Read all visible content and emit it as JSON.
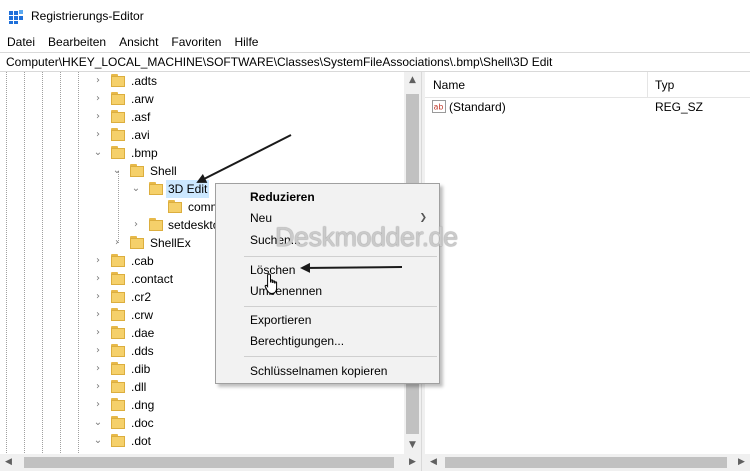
{
  "window": {
    "title": "Registrierungs-Editor"
  },
  "menu": [
    "Datei",
    "Bearbeiten",
    "Ansicht",
    "Favoriten",
    "Hilfe"
  ],
  "address": "Computer\\HKEY_LOCAL_MACHINE\\SOFTWARE\\Classes\\SystemFileAssociations\\.bmp\\Shell\\3D Edit",
  "tree": {
    "items": [
      {
        "label": ".adts"
      },
      {
        "label": ".arw"
      },
      {
        "label": ".asf"
      },
      {
        "label": ".avi"
      },
      {
        "label": ".bmp"
      },
      {
        "label": "Shell"
      },
      {
        "label": "3D Edit"
      },
      {
        "label": "comm"
      },
      {
        "label": "setdeskto"
      },
      {
        "label": "ShellEx"
      },
      {
        "label": ".cab"
      },
      {
        "label": ".contact"
      },
      {
        "label": ".cr2"
      },
      {
        "label": ".crw"
      },
      {
        "label": ".dae"
      },
      {
        "label": ".dds"
      },
      {
        "label": ".dib"
      },
      {
        "label": ".dll"
      },
      {
        "label": ".dng"
      },
      {
        "label": ".doc"
      },
      {
        "label": ".dot"
      }
    ]
  },
  "list": {
    "columns": {
      "name": "Name",
      "type": "Typ"
    },
    "rows": [
      {
        "name": "(Standard)",
        "type": "REG_SZ"
      }
    ]
  },
  "context_menu": {
    "collapse": "Reduzieren",
    "new": "Neu",
    "find": "Suchen...",
    "delete": "Löschen",
    "rename": "Umbenennen",
    "export": "Exportieren",
    "permissions": "Berechtigungen...",
    "copy_key_name": "Schlüsselnamen kopieren"
  },
  "watermark": "Deskmodder.de",
  "colors": {
    "selection": "#cce8ff",
    "folder": "#f5d06a",
    "menu_bg": "#f2f2f2"
  }
}
